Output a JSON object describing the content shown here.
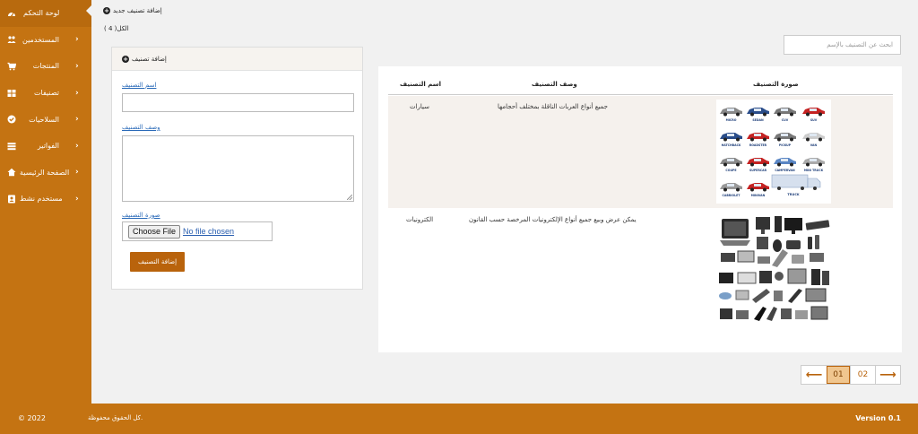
{
  "sidebar": {
    "items": [
      {
        "label": "لوحة التحكم",
        "icon": "dashboard-icon",
        "has_submenu": false
      },
      {
        "label": "المستخدمين",
        "icon": "users-icon",
        "has_submenu": true
      },
      {
        "label": "المنتجات",
        "icon": "cart-icon",
        "has_submenu": true
      },
      {
        "label": "تصنيفات",
        "icon": "grid-icon",
        "has_submenu": true
      },
      {
        "label": "السلاحيات",
        "icon": "check-circle-icon",
        "has_submenu": true
      },
      {
        "label": "الفواتير",
        "icon": "list-icon",
        "has_submenu": true
      },
      {
        "label": "الصفحة الرئيسية",
        "icon": "home-icon",
        "has_submenu": true
      },
      {
        "label": "مستخدم نشط",
        "icon": "user-badge-icon",
        "has_submenu": true
      }
    ]
  },
  "actions": {
    "add_new_label": "إضافة تصنيف جديد",
    "total_label": "الكل( 4 )"
  },
  "form": {
    "header": "إضافة تصنيف",
    "name_label": "اسم التصنيف",
    "description_label": "وصف التصنيف",
    "image_label": "صورة التصنيف",
    "choose_file_label": "Choose File",
    "no_file_label": "No file chosen",
    "submit_label": "إضافة التصنيف"
  },
  "search": {
    "placeholder": "ابحث عن التصنيف بالإسم"
  },
  "table": {
    "headers": {
      "name": "اسم التصنيف",
      "description": "وصف التصنيف",
      "image": "صورة التصنيف"
    },
    "rows": [
      {
        "name": "سيارات",
        "description": "جميع أنواع العربات الناقلة بمختلف أحجامها",
        "image_alt": "cars-thumbnail"
      },
      {
        "name": "الكترونيات",
        "description": "يمكن عرض وبيع جميع أنواع الإلكترونيات المرخصة حسب القانون",
        "image_alt": "electronics-thumbnail"
      }
    ],
    "car_labels": [
      "MICRO",
      "SEDAN",
      "CUV",
      "SUV",
      "HATCHBACK",
      "ROADSTER",
      "PICKUP",
      "VAN",
      "COUPE",
      "SUPERCAR",
      "CAMPERVAN",
      "MINI TRUCK",
      "CABRIOLET",
      "MINIVAN",
      "",
      "TRUCK"
    ]
  },
  "pagination": {
    "pages": [
      "01",
      "02"
    ],
    "current": "01"
  },
  "footer": {
    "copyright": "© 2022",
    "rights": "كل الحقوق محفوظة.",
    "version": "Version 0.1"
  },
  "colors": {
    "brand": "#c47312",
    "button": "#b9630c",
    "link": "#2a6ab8"
  }
}
